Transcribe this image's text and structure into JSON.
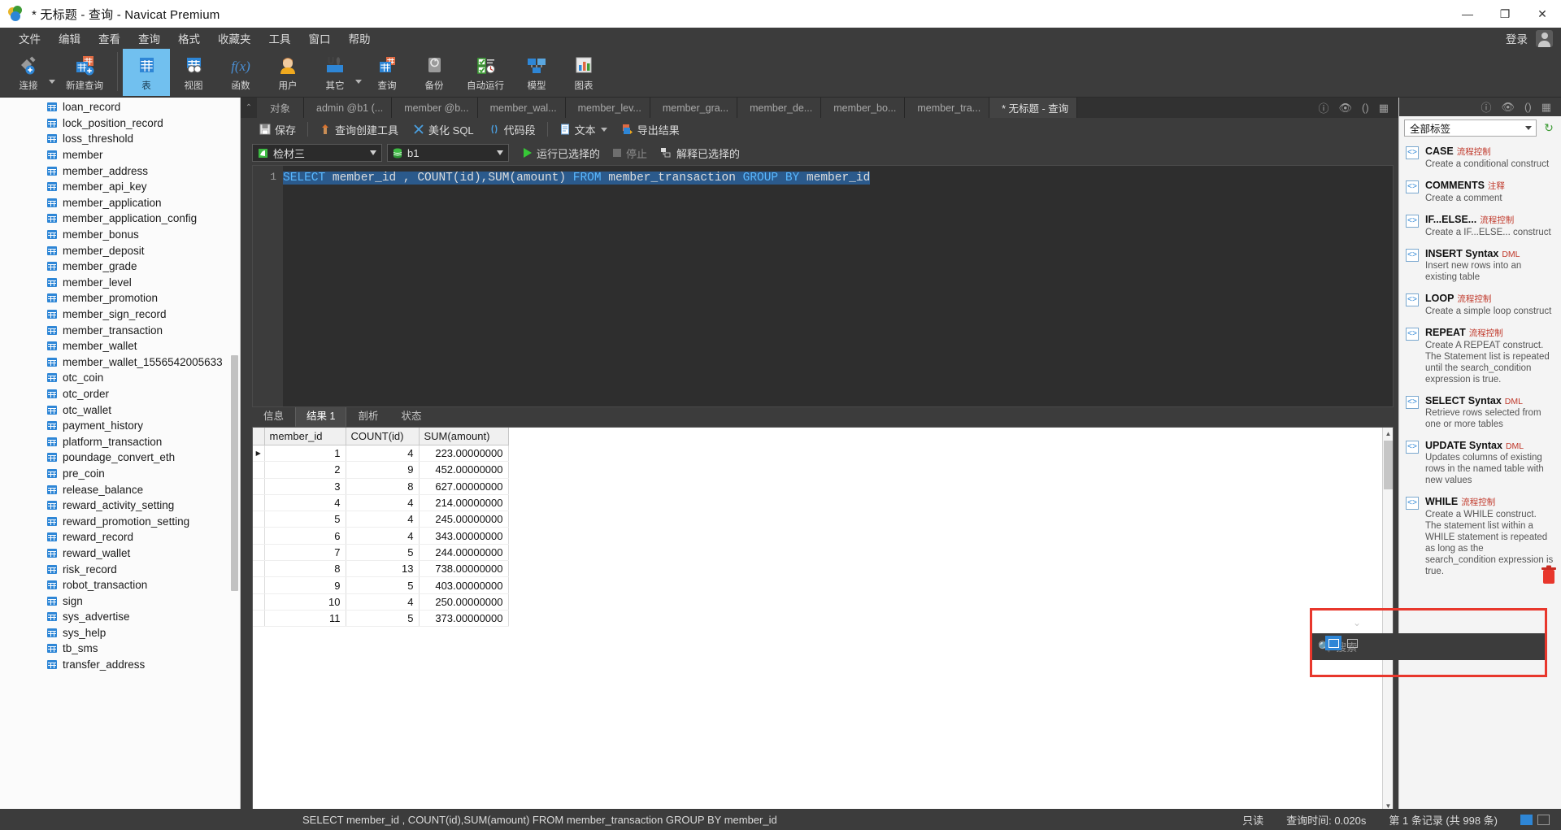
{
  "window": {
    "title": "* 无标题 - 查询 - Navicat Premium",
    "minimize": "—",
    "maximize": "❐",
    "close": "✕"
  },
  "menubar": {
    "items": [
      "文件",
      "编辑",
      "查看",
      "查询",
      "格式",
      "收藏夹",
      "工具",
      "窗口",
      "帮助"
    ],
    "login_label": "登录"
  },
  "main_toolbar": {
    "items": [
      {
        "label": "连接",
        "icon": "connection-icon",
        "has_arrow": true
      },
      {
        "label": "新建查询",
        "icon": "new-query-icon",
        "has_arrow": false
      },
      {
        "label": "表",
        "icon": "table-icon",
        "active": true
      },
      {
        "label": "视图",
        "icon": "view-icon"
      },
      {
        "label": "函数",
        "icon": "function-icon"
      },
      {
        "label": "用户",
        "icon": "user-icon"
      },
      {
        "label": "其它",
        "icon": "others-icon",
        "has_arrow": true
      },
      {
        "label": "查询",
        "icon": "query-icon"
      },
      {
        "label": "备份",
        "icon": "backup-icon"
      },
      {
        "label": "自动运行",
        "icon": "automation-icon"
      },
      {
        "label": "模型",
        "icon": "model-icon"
      },
      {
        "label": "图表",
        "icon": "chart-icon"
      }
    ]
  },
  "sidebar": {
    "tables": [
      "loan_record",
      "lock_position_record",
      "loss_threshold",
      "member",
      "member_address",
      "member_api_key",
      "member_application",
      "member_application_config",
      "member_bonus",
      "member_deposit",
      "member_grade",
      "member_level",
      "member_promotion",
      "member_sign_record",
      "member_transaction",
      "member_wallet",
      "member_wallet_1556542005633",
      "otc_coin",
      "otc_order",
      "otc_wallet",
      "payment_history",
      "platform_transaction",
      "poundage_convert_eth",
      "pre_coin",
      "release_balance",
      "reward_activity_setting",
      "reward_promotion_setting",
      "reward_record",
      "reward_wallet",
      "risk_record",
      "robot_transaction",
      "sign",
      "sys_advertise",
      "sys_help",
      "tb_sms",
      "transfer_address"
    ]
  },
  "tabs": {
    "object_tab": "对象",
    "items": [
      {
        "label": "admin @b1 (...",
        "icon": "table-icon",
        "active": false
      },
      {
        "label": "member @b...",
        "icon": "table-icon",
        "active": false
      },
      {
        "label": "member_wal...",
        "icon": "table-icon",
        "active": false
      },
      {
        "label": "member_lev...",
        "icon": "table-icon",
        "active": false
      },
      {
        "label": "member_gra...",
        "icon": "table-icon",
        "active": false
      },
      {
        "label": "member_de...",
        "icon": "table-icon",
        "active": false
      },
      {
        "label": "member_bo...",
        "icon": "table-icon",
        "active": false
      },
      {
        "label": "member_tra...",
        "icon": "table-icon",
        "active": false
      },
      {
        "label": "* 无标题 - 查询",
        "icon": "query-doc-icon",
        "active": true
      }
    ]
  },
  "query_toolbar": {
    "save": "保存",
    "query_builder": "查询创建工具",
    "beautify_sql": "美化 SQL",
    "code_snippet": "代码段",
    "text": "文本",
    "export_result": "导出结果"
  },
  "query_controls": {
    "connection": "检材三",
    "database": "b1",
    "run_selected": "运行已选择的",
    "stop": "停止",
    "explain_selected": "解释已选择的"
  },
  "editor": {
    "line_number": "1",
    "sql_part_1": "SELECT",
    "sql_part_2": " member_id , COUNT(id),SUM(amount) ",
    "sql_part_3": "FROM",
    "sql_part_4": " member_transaction ",
    "sql_part_5": "GROUP",
    "sql_part_6": " ",
    "sql_part_7": "BY",
    "sql_part_8": " member_id",
    "full_sql": "SELECT member_id , COUNT(id),SUM(amount) FROM member_transaction GROUP BY member_id"
  },
  "result_tabs": [
    {
      "label": "信息",
      "active": false
    },
    {
      "label": "结果 1",
      "active": true
    },
    {
      "label": "剖析",
      "active": false
    },
    {
      "label": "状态",
      "active": false
    }
  ],
  "result_grid": {
    "columns": [
      "member_id",
      "COUNT(id)",
      "SUM(amount)"
    ],
    "rows": [
      [
        "1",
        "4",
        "223.00000000"
      ],
      [
        "2",
        "9",
        "452.00000000"
      ],
      [
        "3",
        "8",
        "627.00000000"
      ],
      [
        "4",
        "4",
        "214.00000000"
      ],
      [
        "5",
        "4",
        "245.00000000"
      ],
      [
        "6",
        "4",
        "343.00000000"
      ],
      [
        "7",
        "5",
        "244.00000000"
      ],
      [
        "8",
        "13",
        "738.00000000"
      ],
      [
        "9",
        "5",
        "403.00000000"
      ],
      [
        "10",
        "4",
        "250.00000000"
      ],
      [
        "11",
        "5",
        "373.00000000"
      ]
    ],
    "current_row_index": 0
  },
  "grid_footer": {
    "buttons": [
      "+",
      "−",
      "✓",
      "✕",
      "↻",
      "▣"
    ]
  },
  "right_panel": {
    "filter_label": "全部标签",
    "snippets": [
      {
        "title": "CASE",
        "badge": "流程控制",
        "desc": "Create a conditional construct"
      },
      {
        "title": "COMMENTS",
        "badge": "注释",
        "desc": "Create a comment"
      },
      {
        "title": "IF...ELSE...",
        "badge": "流程控制",
        "desc": "Create a IF...ELSE... construct"
      },
      {
        "title": "INSERT Syntax",
        "badge": "DML",
        "desc": "Insert new rows into an existing table"
      },
      {
        "title": "LOOP",
        "badge": "流程控制",
        "desc": "Create a simple loop construct"
      },
      {
        "title": "REPEAT",
        "badge": "流程控制",
        "desc": "Create A REPEAT construct. The Statement list is repeated until the search_condition expression is true."
      },
      {
        "title": "SELECT Syntax",
        "badge": "DML",
        "desc": "Retrieve rows selected from one or more tables"
      },
      {
        "title": "UPDATE Syntax",
        "badge": "DML",
        "desc": "Updates columns of existing rows in the named table with new values"
      },
      {
        "title": "WHILE",
        "badge": "流程控制",
        "desc": "Create a WHILE construct. The statement list within a WHILE statement is repeated as long as the search_condition expression is true."
      }
    ]
  },
  "status_bar": {
    "sql_text": "SELECT member_id , COUNT(id),SUM(amount) FROM member_transaction GROUP BY member_id",
    "readonly": "只读",
    "query_time": "查询时间: 0.020s",
    "record_info": "第 1 条记录 (共 998 条)"
  },
  "search_overlay": {
    "placeholder": "搜索"
  },
  "colors": {
    "accent": "#2e86d6",
    "toolbar_bg": "#3c3c3c",
    "active_tab": "#71c0ef",
    "highlight_red": "#e8372c",
    "sql_keyword": "#59b8ff",
    "selection": "#2b5a8c"
  }
}
